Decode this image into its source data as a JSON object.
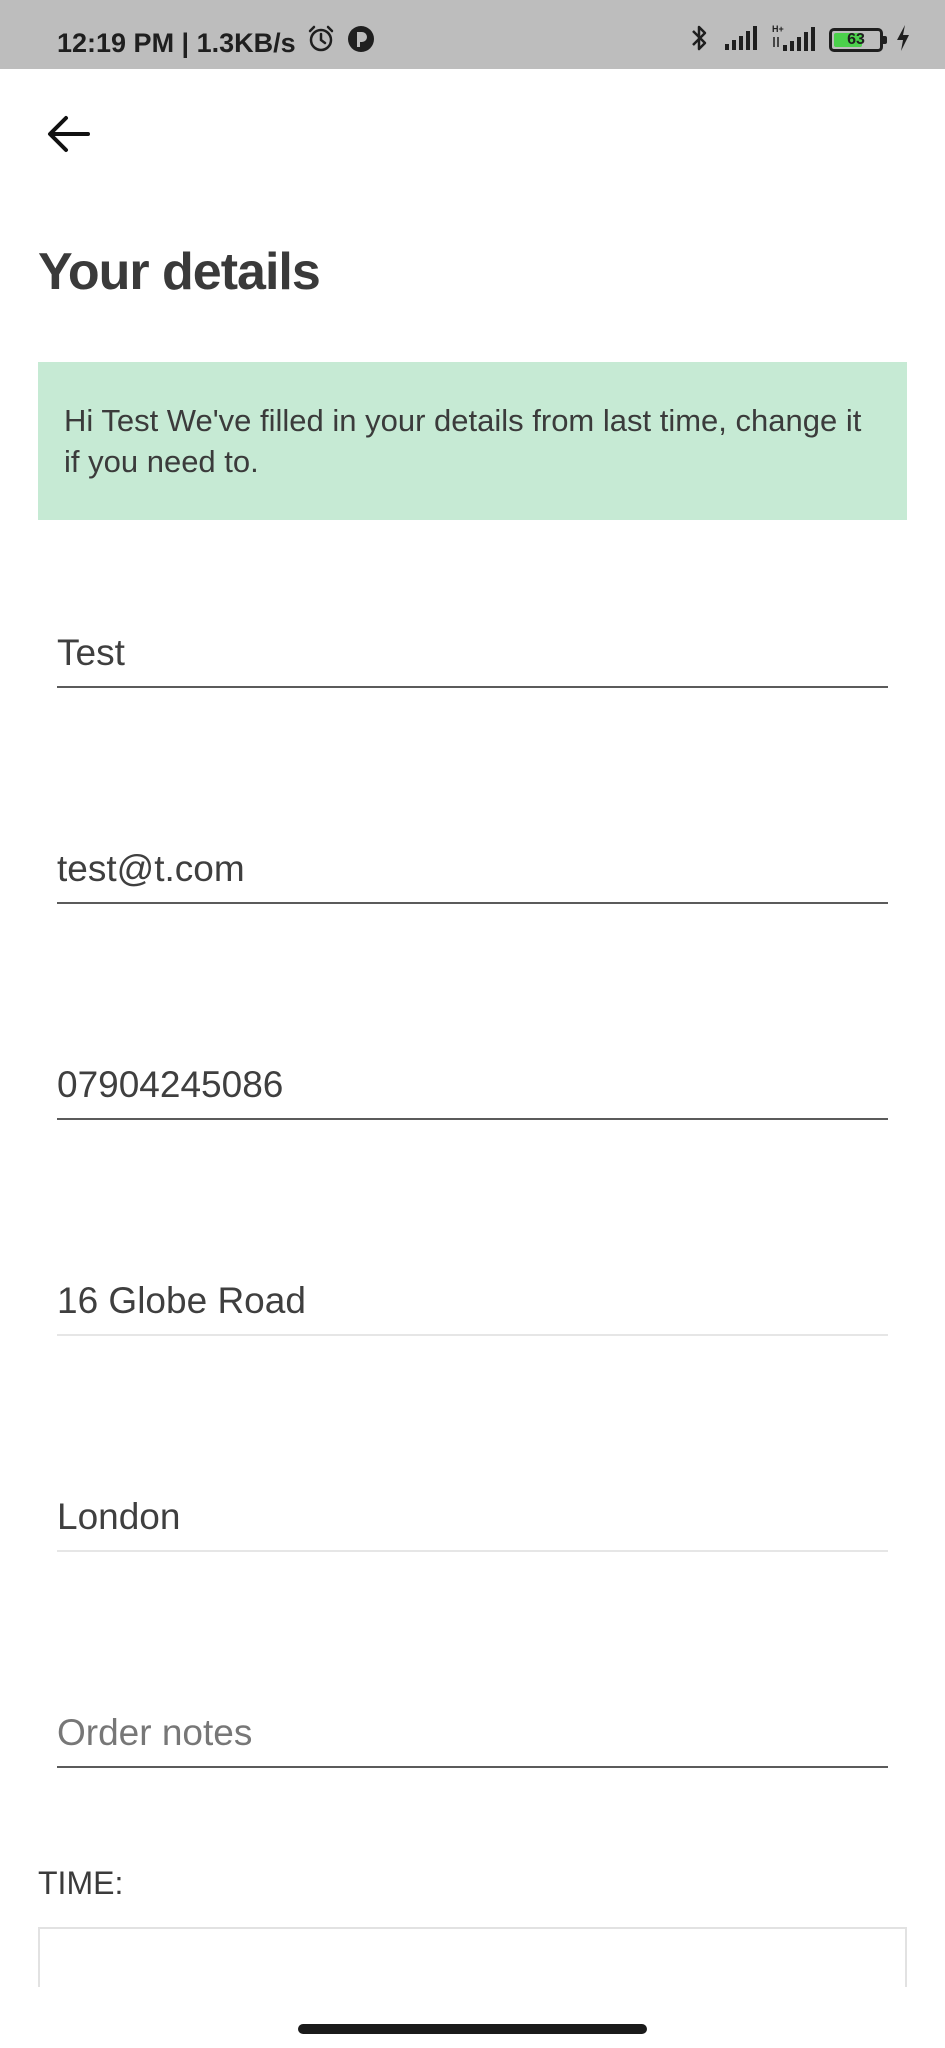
{
  "status_bar": {
    "time_speed": "12:19 PM | 1.3KB/s",
    "battery_level": "63",
    "icons": [
      "alarm-icon",
      "app-notification-icon",
      "bluetooth-icon",
      "signal-icon",
      "signal-hplus-icon",
      "battery-icon",
      "charging-icon"
    ]
  },
  "header": {
    "back_icon": "arrow-left-icon",
    "title": "Your details"
  },
  "banner": {
    "message": "Hi Test We've filled in your details from last time, change it if you need to.",
    "background": "#c6ead4"
  },
  "form": {
    "name": {
      "value": "Test"
    },
    "email": {
      "value": "test@t.com"
    },
    "phone": {
      "value": "07904245086"
    },
    "address": {
      "value": "16 Globe Road"
    },
    "city": {
      "value": "London"
    },
    "notes": {
      "value": "",
      "placeholder": "Order notes"
    }
  },
  "time": {
    "label": "TIME:"
  }
}
